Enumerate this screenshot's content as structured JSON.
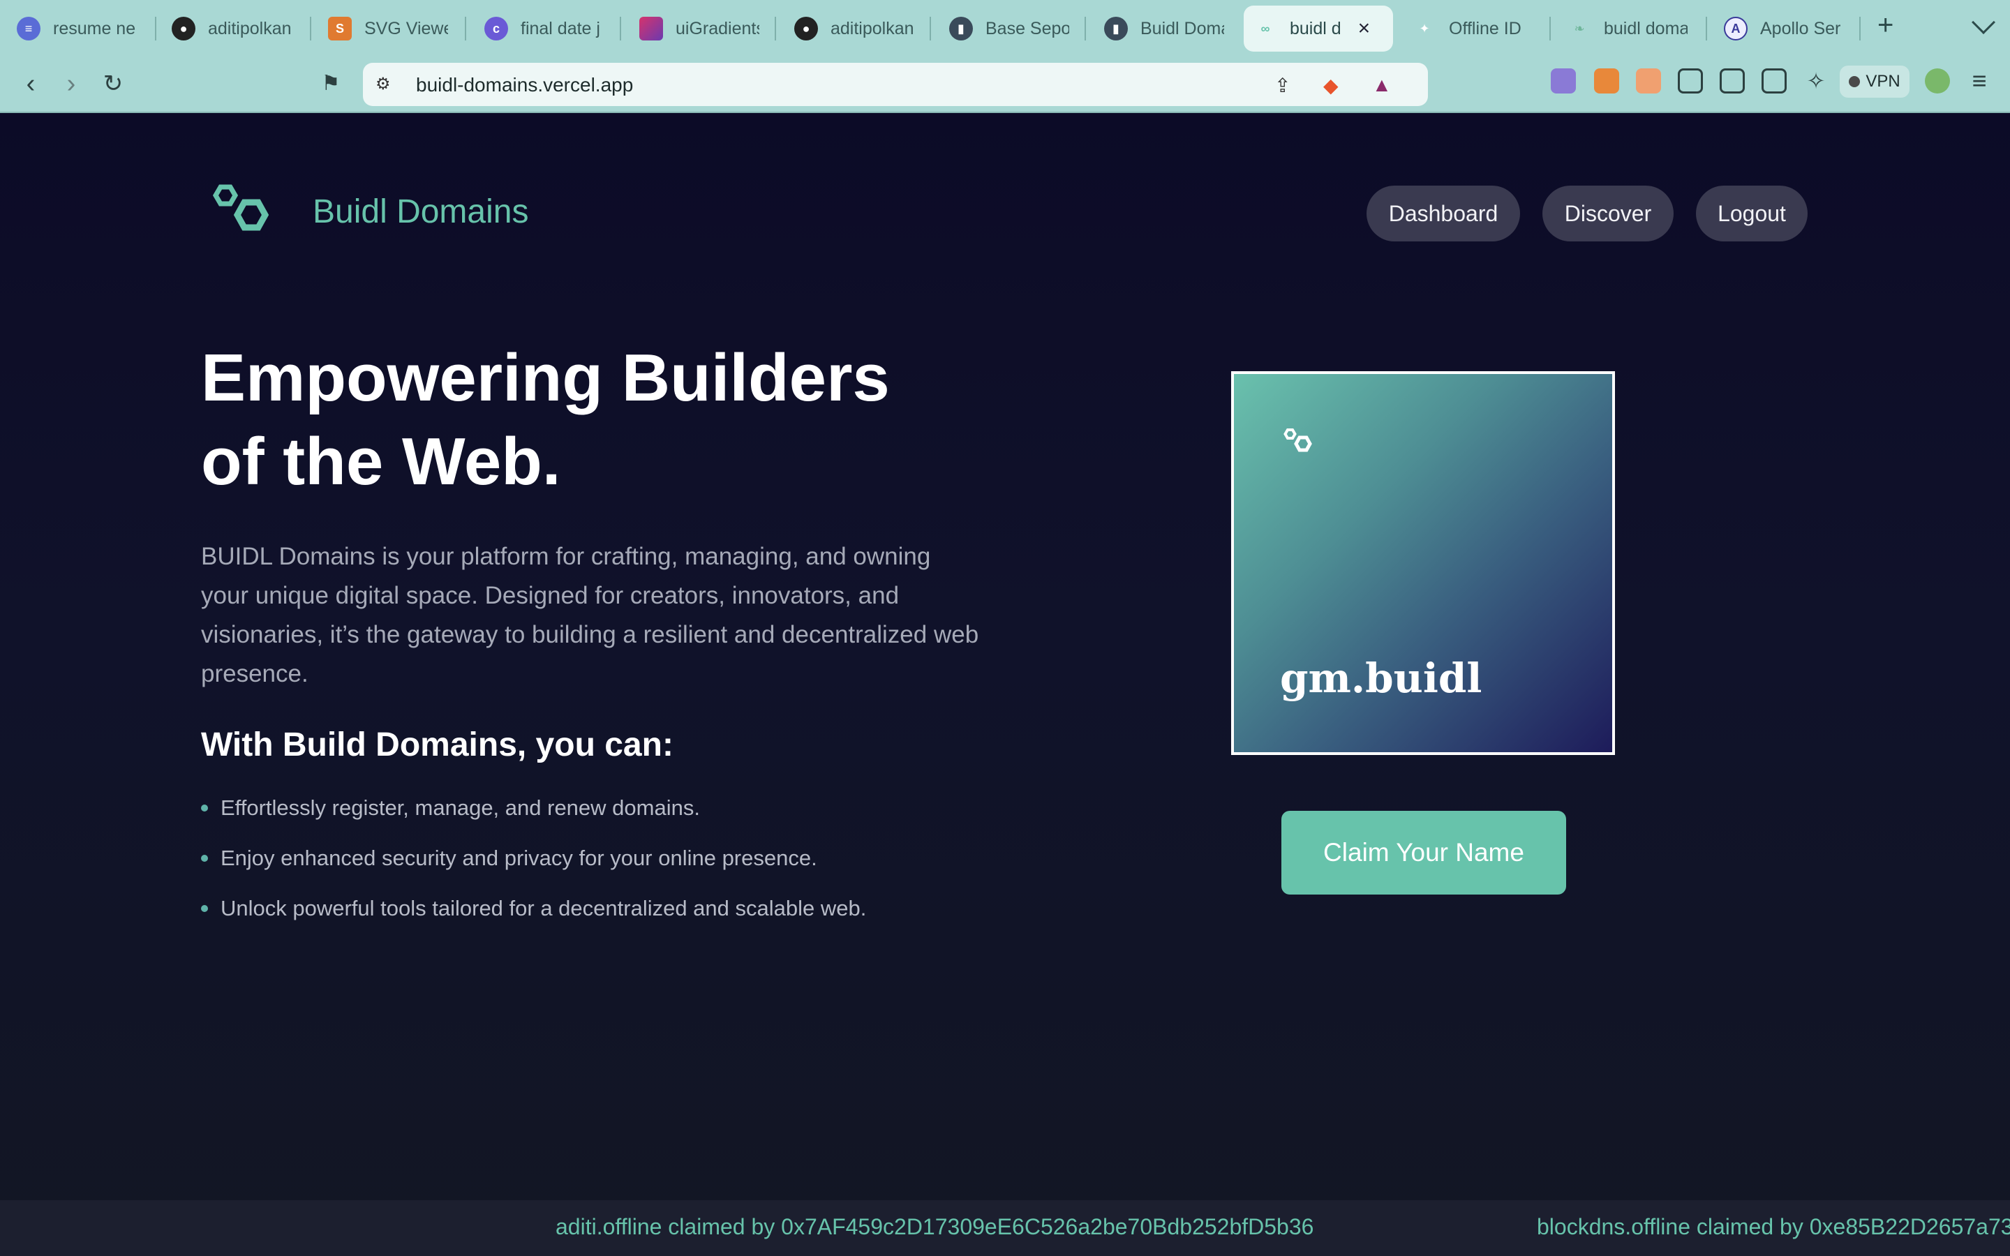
{
  "browser": {
    "tabs": [
      {
        "title": "resume ne",
        "icon": "document-icon",
        "color": "#5a6cd6"
      },
      {
        "title": "aditipolkan",
        "icon": "github-icon",
        "color": "#222222"
      },
      {
        "title": "SVG Viewe",
        "icon": "svg-viewer-icon",
        "color": "#e07a30"
      },
      {
        "title": "final date j",
        "icon": "calendar-icon",
        "color": "#6a5ad6"
      },
      {
        "title": "uiGradients",
        "icon": "gradient-icon",
        "color": "#c4427a"
      },
      {
        "title": "aditipolkan",
        "icon": "github-icon",
        "color": "#222222"
      },
      {
        "title": "Base Sepo",
        "icon": "chart-icon",
        "color": "#3a4a5a"
      },
      {
        "title": "Buidl Doma",
        "icon": "chart-icon",
        "color": "#3a4a5a"
      },
      {
        "title": "buidl d",
        "icon": "hexagons-icon",
        "color": "#67c3ab"
      },
      {
        "title": "Offline ID",
        "icon": "puzzle-icon",
        "color": "#ffffff"
      },
      {
        "title": "buidl doma",
        "icon": "leaf-icon",
        "color": "#6fb69a"
      },
      {
        "title": "Apollo Ser",
        "icon": "apollo-icon",
        "color": "#3a3a9a"
      }
    ],
    "active_tab_index": 8,
    "url": "buidl-domains.vercel.app",
    "vpn_label": "VPN"
  },
  "page": {
    "brand_name": "Buidl Domains",
    "nav": {
      "dashboard": "Dashboard",
      "discover": "Discover",
      "logout": "Logout"
    },
    "hero": {
      "title_line1": "Empowering Builders",
      "title_line2": "of the Web.",
      "description": "BUIDL Domains is your platform for crafting, managing, and owning your unique digital space. Designed for creators, innovators, and visionaries, it’s the gateway to building a resilient and decentralized web presence."
    },
    "features_heading": "With Build Domains, you can:",
    "features": [
      "Effortlessly register, manage, and renew domains.",
      "Enjoy enhanced security and privacy for your online presence.",
      "Unlock powerful tools tailored for a decentralized and scalable web."
    ],
    "card": {
      "domain": "gm.buidl"
    },
    "claim_button": "Claim Your Name",
    "ticker": [
      "aditi.offline claimed by 0x7AF459c2D17309eE6C526a2be70Bdb252bfD5b36",
      "blockdns.offline claimed by 0xe85B22D2657a73"
    ]
  },
  "colors": {
    "accent": "#67c3ab",
    "background": "#0e0e24",
    "pill": "#3a3a50"
  }
}
